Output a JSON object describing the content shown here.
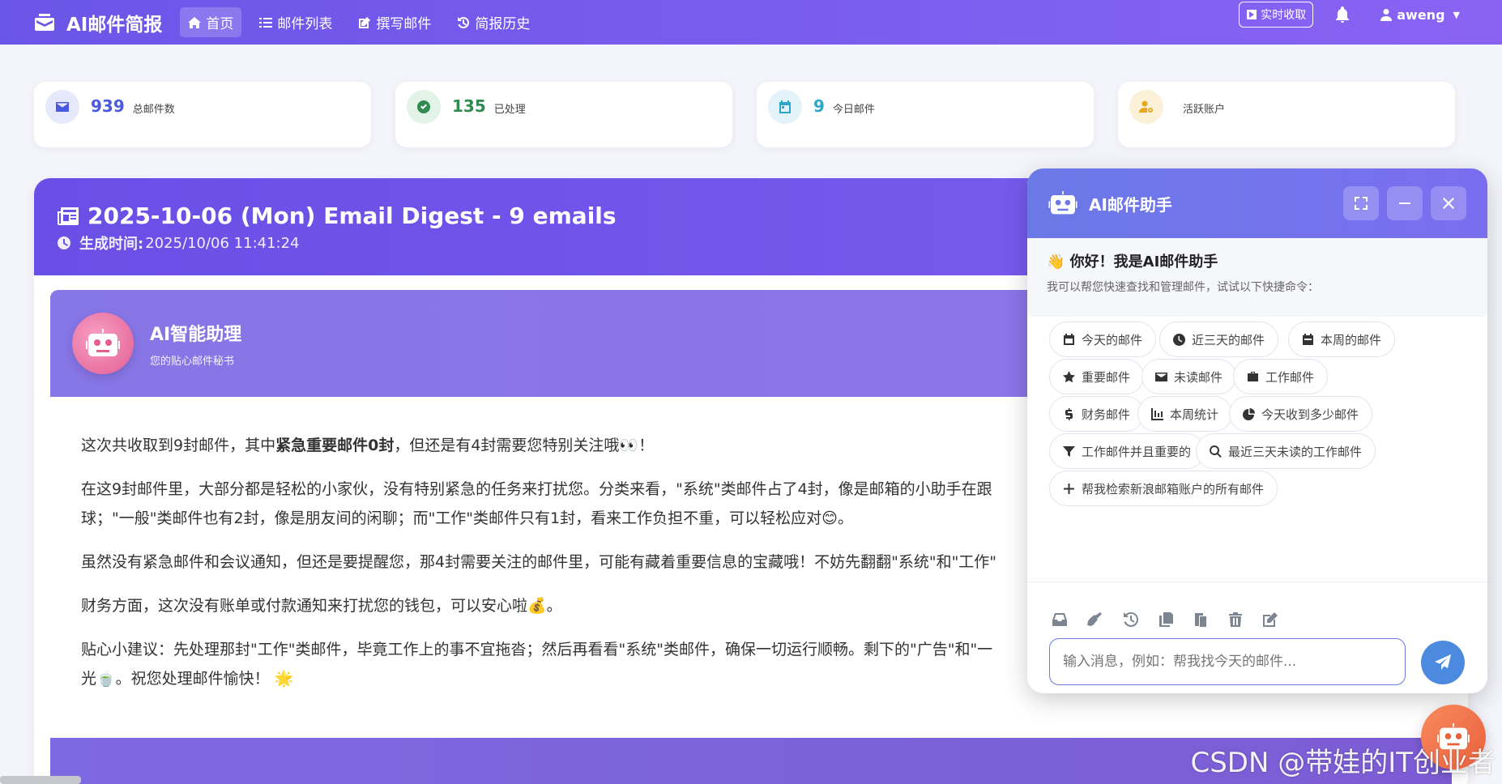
{
  "nav": {
    "brand": "AI邮件简报",
    "items": [
      {
        "label": "首页",
        "icon": "home-icon",
        "active": true
      },
      {
        "label": "邮件列表",
        "icon": "list-icon",
        "active": false
      },
      {
        "label": "撰写邮件",
        "icon": "edit-icon",
        "active": false
      },
      {
        "label": "简报历史",
        "icon": "history-icon",
        "active": false
      }
    ],
    "realtime_label": "实时收取",
    "username": "aweng"
  },
  "stats": [
    {
      "value": "939",
      "label": "总邮件数",
      "icon": "envelope-icon",
      "color": "#4a5ae0",
      "bg": "#e6e9fb"
    },
    {
      "value": "135",
      "label": "已处理",
      "icon": "check-circle-icon",
      "color": "#2f8b4f",
      "bg": "#e3f3e7"
    },
    {
      "value": "9",
      "label": "今日邮件",
      "icon": "calendar-icon",
      "color": "#2aa7c9",
      "bg": "#e2f4f9"
    },
    {
      "value": "",
      "label": "活跃账户",
      "icon": "user-cog-icon",
      "color": "#e8a71c",
      "bg": "#fbf1d8"
    }
  ],
  "digest": {
    "title": "2025-10-06 (Mon) Email Digest - 9 emails",
    "generated_label": "生成时间:",
    "generated_time": "2025/10/06 11:41:24",
    "assistant_name": "AI智能助理",
    "assistant_subtitle": "您的贴心邮件秘书",
    "paragraphs": [
      {
        "pre": "这次共收取到9封邮件，其中",
        "bold": "紧急重要邮件0封",
        "post": "，但还是有4封需要您特别关注哦👀！"
      },
      {
        "pre": "在这9封邮件里，大部分都是轻松的小家伙，没有特别紧急的任务来打扰您。分类来看，\"系统\"类邮件占了4封，像是邮箱的小助手在跟",
        "bold": "",
        "post": ""
      },
      {
        "pre": "球；\"一般\"类邮件也有2封，像是朋友间的闲聊；而\"工作\"类邮件只有1封，看来工作负担不重，可以轻松应对😊。",
        "bold": "",
        "post": ""
      },
      {
        "pre": "虽然没有紧急邮件和会议通知，但还是要提醒您，那4封需要关注的邮件里，可能有藏着重要信息的宝藏哦！不妨先翻翻\"系统\"和\"工作\"",
        "bold": "",
        "post": ""
      },
      {
        "pre": "财务方面，这次没有账单或付款通知来打扰您的钱包，可以安心啦💰。",
        "bold": "",
        "post": ""
      },
      {
        "pre": "贴心小建议：先处理那封\"工作\"类邮件，毕竟工作上的事不宜拖沓；然后再看看\"系统\"类邮件，确保一切运行顺畅。剩下的\"广告\"和\"一",
        "bold": "",
        "post": ""
      },
      {
        "pre": "光🍵。祝您处理邮件愉快！ 🌟",
        "bold": "",
        "post": ""
      }
    ]
  },
  "chat": {
    "title": "AI邮件助手",
    "greeting": "👋 你好！我是AI邮件助手",
    "hint": "我可以帮您快速查找和管理邮件，试试以下快捷命令：",
    "chips": [
      {
        "label": "今天的邮件",
        "icon": "calendar-icon"
      },
      {
        "label": "近三天的邮件",
        "icon": "clock-icon"
      },
      {
        "label": "本周的邮件",
        "icon": "calendar-week-icon"
      },
      {
        "label": "重要邮件",
        "icon": "star-icon"
      },
      {
        "label": "未读邮件",
        "icon": "envelope-icon"
      },
      {
        "label": "工作邮件",
        "icon": "briefcase-icon"
      },
      {
        "label": "财务邮件",
        "icon": "dollar-icon"
      },
      {
        "label": "本周统计",
        "icon": "chart-icon"
      },
      {
        "label": "今天收到多少邮件",
        "icon": "pie-icon"
      },
      {
        "label": "工作邮件并且重要的",
        "icon": "filter-icon"
      },
      {
        "label": "最近三天未读的工作邮件",
        "icon": "search-icon"
      },
      {
        "label": "帮我检索新浪邮箱账户的所有邮件",
        "icon": "plus-icon"
      }
    ],
    "input_placeholder": "输入消息，例如：帮我找今天的邮件..."
  },
  "watermark": "CSDN @带娃的IT创业者"
}
